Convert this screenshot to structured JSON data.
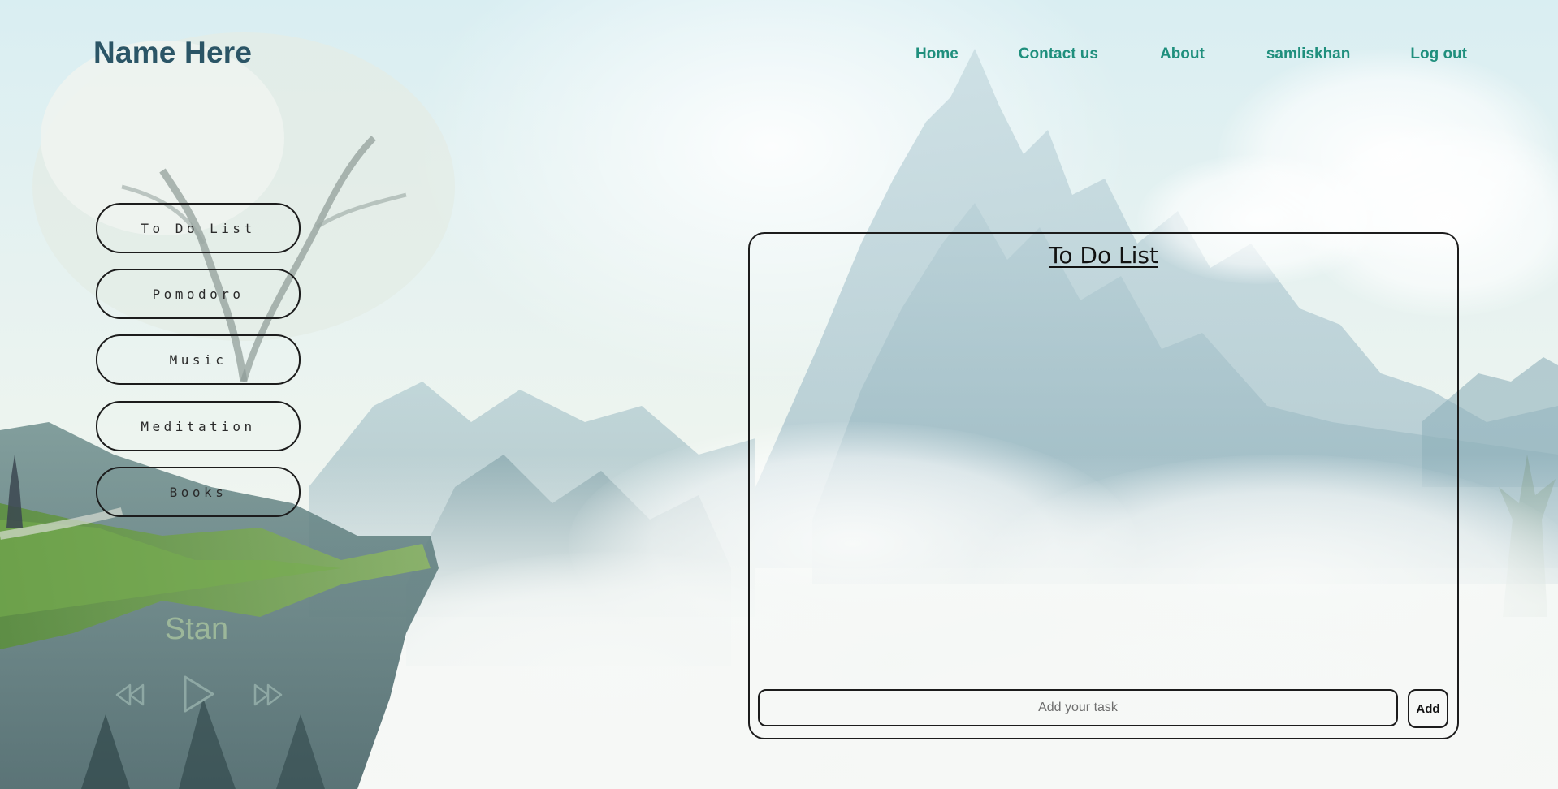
{
  "header": {
    "brand": "Name Here",
    "nav": {
      "home": "Home",
      "contact": "Contact us",
      "about": "About",
      "user": "samliskhan",
      "logout": "Log out"
    }
  },
  "sidebar": {
    "items": [
      {
        "label": "To Do List"
      },
      {
        "label": "Pomodoro"
      },
      {
        "label": "Music"
      },
      {
        "label": "Meditation"
      },
      {
        "label": "Books"
      }
    ]
  },
  "player": {
    "title": "Stan",
    "controls": [
      "rewind-icon",
      "play-icon",
      "fast-forward-icon"
    ]
  },
  "todo": {
    "title": "To Do List",
    "input_placeholder": "Add your task",
    "input_value": "",
    "add_label": "Add"
  },
  "colors": {
    "brand": "#2b5566",
    "nav": "#1f8f7d",
    "song": "#9cb79a",
    "border": "#1c1c1c"
  }
}
